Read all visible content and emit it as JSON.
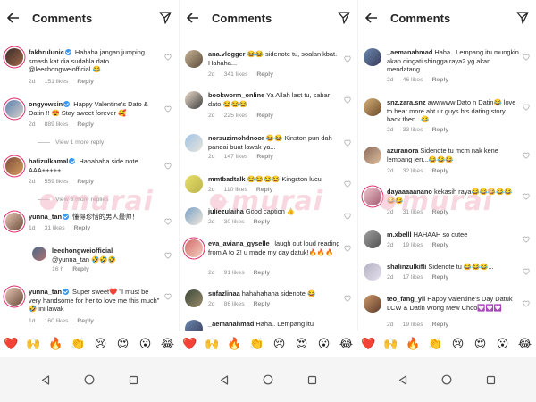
{
  "panels": [
    {
      "title": "Comments",
      "comments": [
        {
          "user": "fakhrulunic",
          "verified": true,
          "text": "Hahaha jangan jumping smash kat dia sudahla dato @leechongweiofficial 😂",
          "time": "2d",
          "likes": "151 likes",
          "reply": "Reply"
        },
        {
          "user": "ongyewsin",
          "verified": true,
          "text": "Happy Valentine's Dato & Datin !! 😍 Stay sweet forever 🥰",
          "time": "2d",
          "likes": "889 likes",
          "reply": "Reply",
          "view_more": "View 1 more reply"
        },
        {
          "user": "hafizulkamal",
          "verified": true,
          "text": "Hahahaha side note AAA+++++",
          "time": "2d",
          "likes": "559 likes",
          "reply": "Reply",
          "view_more": "View 3 more replies"
        },
        {
          "user": "yunna_tan",
          "verified": true,
          "text": "懂得珍惜的男人最帅！",
          "time": "1d",
          "likes": "31 likes",
          "reply": "Reply"
        },
        {
          "user": "leechongweiofficial",
          "verified": false,
          "text": "@yunna_tan 🤣🤣🤣",
          "time": "16 h",
          "likes": "",
          "reply": "Reply"
        },
        {
          "user": "yunna_tan",
          "verified": true,
          "text": "Super sweet❤️ \"I must be very handsome for her to love me this much\" 🤣 ini lawak",
          "time": "1d",
          "likes": "160 likes",
          "reply": "Reply"
        }
      ]
    },
    {
      "title": "Comments",
      "comments": [
        {
          "user": "ana.vlogger",
          "verified": false,
          "text": "😂😂 sidenote tu, soalan kbat. Hahaha...",
          "time": "2d",
          "likes": "341 likes",
          "reply": "Reply"
        },
        {
          "user": "bookworm_online",
          "verified": false,
          "text": "Ya Allah last tu, sabar dato 😂😂😂",
          "time": "2d",
          "likes": "225 likes",
          "reply": "Reply"
        },
        {
          "user": "norsuzimohdnoor",
          "verified": false,
          "text": "😂😂 Kinston pun dah pandai buat lawak ya...",
          "time": "2d",
          "likes": "147 likes",
          "reply": "Reply"
        },
        {
          "user": "mmtbadtalk",
          "verified": false,
          "text": "😂😂😂😂 Kingston lucu",
          "time": "2d",
          "likes": "110 likes",
          "reply": "Reply"
        },
        {
          "user": "juliezulaiha",
          "verified": false,
          "text": "Good caption 👍",
          "time": "2d",
          "likes": "30 likes",
          "reply": "Reply"
        },
        {
          "user": "eva_aviana_gyselle",
          "verified": false,
          "text": "i laugh out loud reading from A to Z! u made my day datuk!🔥🔥🔥",
          "time": "2d",
          "likes": "91 likes",
          "reply": "Reply"
        },
        {
          "user": "snfazlinaa",
          "verified": false,
          "text": "hahahahaha sidenote 😂",
          "time": "2d",
          "likes": "86 likes",
          "reply": "Reply"
        },
        {
          "user": "_aemanahmad",
          "verified": false,
          "text": "Haha.. Lempang itu",
          "time": "",
          "likes": "",
          "reply": ""
        }
      ]
    },
    {
      "title": "Comments",
      "comments": [
        {
          "user": "_aemanahmad",
          "verified": false,
          "text": "Haha.. Lempang itu mungkin akan dingati shingga raya2 yg akan mendatang.",
          "time": "2d",
          "likes": "46 likes",
          "reply": "Reply"
        },
        {
          "user": "snz.zara.snz",
          "verified": false,
          "text": "awwwww Dato n Datin😂 love to hear more abt ur guys bts dating story back then...😂",
          "time": "2d",
          "likes": "33 likes",
          "reply": "Reply"
        },
        {
          "user": "azuranora",
          "verified": false,
          "text": "Sidenote tu mcm nak kene lempang jerr...😂😂😂",
          "time": "2d",
          "likes": "32 likes",
          "reply": "Reply"
        },
        {
          "user": "dayaaaaanano",
          "verified": false,
          "text": "kekasih raya😂😂😂😂😂😂😂",
          "time": "2d",
          "likes": "31 likes",
          "reply": "Reply"
        },
        {
          "user": "m.xbelll",
          "verified": false,
          "text": "HAHAAH so cutee",
          "time": "2d",
          "likes": "19 likes",
          "reply": "Reply"
        },
        {
          "user": "shalinzulkifli",
          "verified": false,
          "text": "Sidenote tu 😂😂😂...",
          "time": "2d",
          "likes": "17 likes",
          "reply": "Reply"
        },
        {
          "user": "teo_fang_yii",
          "verified": false,
          "text": "Happy Valentine's Day Datuk LCW & Datin Wong Mew Choo💟💟💟",
          "time": "2d",
          "likes": "19 likes",
          "reply": "Reply"
        }
      ]
    }
  ],
  "emoji_bar": [
    "❤️",
    "🙌",
    "🔥",
    "👏",
    "😢",
    "😍",
    "😮",
    "😂"
  ],
  "watermark": "murai",
  "icons": {
    "back": "back-arrow-icon",
    "filter": "direct-send-icon",
    "like": "heart-outline-icon",
    "nav_back": "triangle-back-icon",
    "nav_home": "circle-home-icon",
    "nav_recents": "square-recents-icon"
  }
}
